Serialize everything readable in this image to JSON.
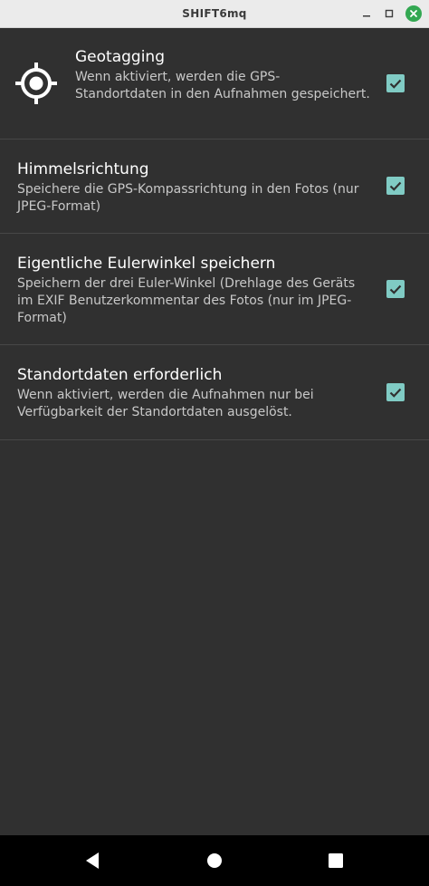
{
  "window": {
    "title": "SHIFT6mq"
  },
  "settings": [
    {
      "title": "Geotagging",
      "summary": "Wenn aktiviert, werden die GPS-Standortdaten in den Aufnahmen gespeichert.",
      "checked": true,
      "icon": "gps-crosshair-icon"
    },
    {
      "title": "Himmelsrichtung",
      "summary": "Speichere die GPS-Kompassrichtung in den Fotos (nur JPEG-Format)",
      "checked": true
    },
    {
      "title": "Eigentliche Eulerwinkel speichern",
      "summary": "Speichern der drei Euler-Winkel (Drehlage des Geräts im EXIF Benutzerkommentar des Fotos (nur im JPEG-Format)",
      "checked": true
    },
    {
      "title": "Standortdaten erforderlich",
      "summary": "Wenn aktiviert, werden die Aufnahmen nur bei Verfügbarkeit der Standortdaten ausgelöst.",
      "checked": true
    }
  ],
  "navbar": {
    "buttons": [
      "back-icon",
      "home-icon",
      "recents-icon"
    ]
  },
  "colors": {
    "background": "#303030",
    "accent": "#80cbc4",
    "divider": "#474747",
    "titlebar": "#ebebeb",
    "close_button": "#33a852"
  }
}
